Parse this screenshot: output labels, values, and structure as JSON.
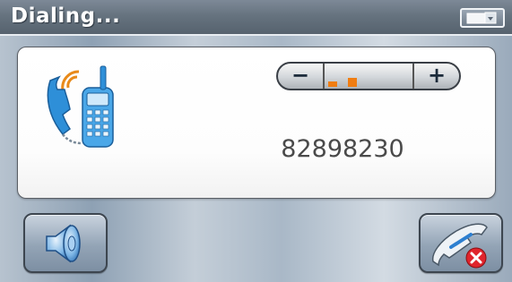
{
  "header": {
    "title": "Dialing..."
  },
  "call": {
    "number": "82898230"
  },
  "volume": {
    "minus_label": "−",
    "plus_label": "+",
    "level": 0.4,
    "bars": 4,
    "accent": "#f07d12"
  },
  "icons": {
    "window": "window-toggle-icon",
    "caller": "phone-handset-icon",
    "speaker": "speaker-icon",
    "hangup": "end-call-icon"
  }
}
